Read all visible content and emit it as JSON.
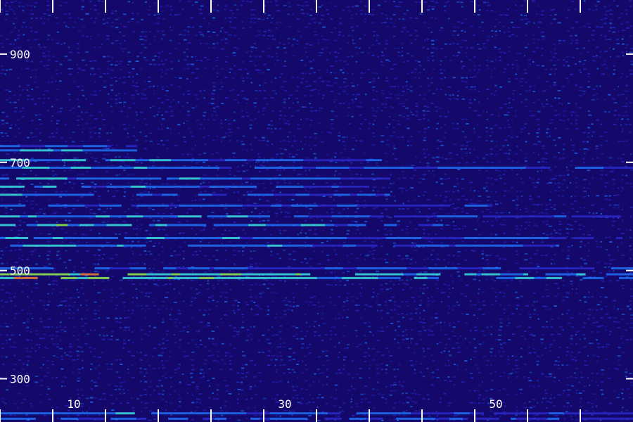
{
  "chart_data": {
    "type": "heatmap",
    "title": "",
    "xlabel": "",
    "ylabel": "",
    "xlim": [
      3,
      63
    ],
    "ylim": [
      220,
      1000
    ],
    "x_tick_labels": [
      "10",
      "30",
      "50"
    ],
    "y_tick_labels": [
      "300",
      "500",
      "700",
      "900"
    ],
    "x_ticks": [
      3,
      8,
      13,
      18,
      23,
      28,
      33,
      38,
      43,
      48,
      53,
      58
    ],
    "x_labeled_ticks": [
      10,
      30,
      50
    ],
    "y_labeled_ticks": [
      300,
      500,
      700,
      900
    ],
    "colormap": [
      "#14086a",
      "#2a2cd0",
      "#1e78ff",
      "#3cf0e8",
      "#9cff4a",
      "#ff8a2a"
    ],
    "background_noise_level": 0.15,
    "bands": [
      {
        "y": 486,
        "intensity": 0.85,
        "x_start": 3,
        "x_end": 63
      },
      {
        "y": 493,
        "intensity": 0.95,
        "x_start": 3,
        "x_end": 63
      },
      {
        "y": 504,
        "intensity": 0.5,
        "x_start": 3,
        "x_end": 63
      },
      {
        "y": 546,
        "intensity": 0.6,
        "x_start": 3,
        "x_end": 56
      },
      {
        "y": 560,
        "intensity": 0.55,
        "x_start": 3,
        "x_end": 62
      },
      {
        "y": 584,
        "intensity": 0.7,
        "x_start": 3,
        "x_end": 45
      },
      {
        "y": 600,
        "intensity": 0.55,
        "x_start": 3,
        "x_end": 63
      },
      {
        "y": 620,
        "intensity": 0.5,
        "x_start": 3,
        "x_end": 50
      },
      {
        "y": 640,
        "intensity": 0.55,
        "x_start": 3,
        "x_end": 40
      },
      {
        "y": 655,
        "intensity": 0.55,
        "x_start": 3,
        "x_end": 38
      },
      {
        "y": 670,
        "intensity": 0.6,
        "x_start": 3,
        "x_end": 40
      },
      {
        "y": 690,
        "intensity": 0.55,
        "x_start": 3,
        "x_end": 63
      },
      {
        "y": 704,
        "intensity": 0.6,
        "x_start": 3,
        "x_end": 40
      },
      {
        "y": 722,
        "intensity": 0.65,
        "x_start": 3,
        "x_end": 16
      },
      {
        "y": 730,
        "intensity": 0.45,
        "x_start": 3,
        "x_end": 16
      },
      {
        "y": 236,
        "intensity": 0.5,
        "x_start": 3,
        "x_end": 63
      },
      {
        "y": 226,
        "intensity": 0.45,
        "x_start": 3,
        "x_end": 63
      }
    ]
  }
}
